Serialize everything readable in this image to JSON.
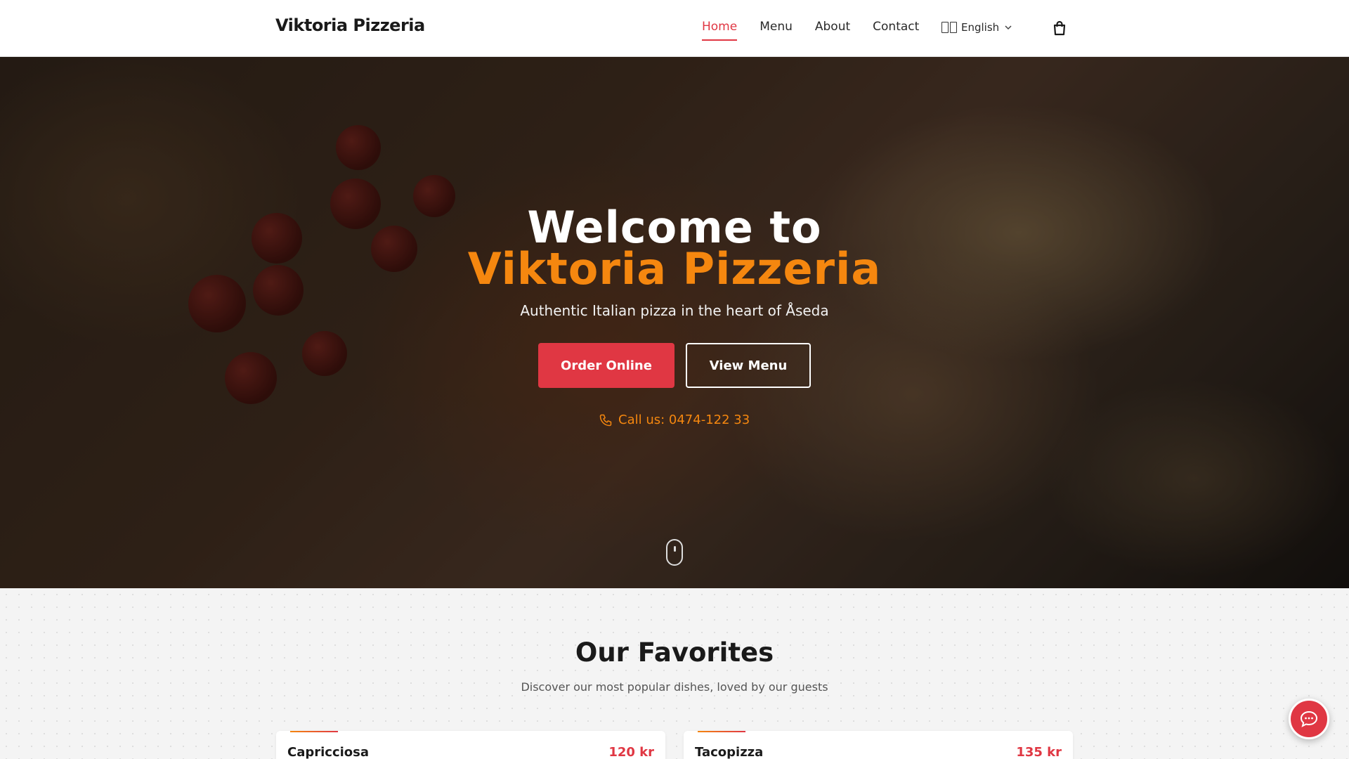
{
  "nav": {
    "brand": "Viktoria Pizzeria",
    "links": [
      {
        "label": "Home",
        "active": true
      },
      {
        "label": "Menu",
        "active": false
      },
      {
        "label": "About",
        "active": false
      },
      {
        "label": "Contact",
        "active": false
      }
    ],
    "language": "English",
    "language_icon": "flag-icon",
    "cart_icon": "shopping-bag-icon"
  },
  "hero": {
    "title_line1": "Welcome to",
    "title_line2": "Viktoria Pizzeria",
    "subtitle": "Authentic Italian pizza in the heart of Åseda",
    "order_button": "Order Online",
    "menu_button": "View Menu",
    "call": "Call us: 0474-122 33"
  },
  "favorites": {
    "title": "Our Favorites",
    "subtitle": "Discover our most popular dishes, loved by our guests",
    "items": [
      {
        "name": "Capricciosa",
        "price": "120 kr"
      },
      {
        "name": "Tacopizza",
        "price": "135 kr"
      }
    ]
  },
  "colors": {
    "accent_red": "#e03743",
    "accent_orange": "#f5870f"
  }
}
